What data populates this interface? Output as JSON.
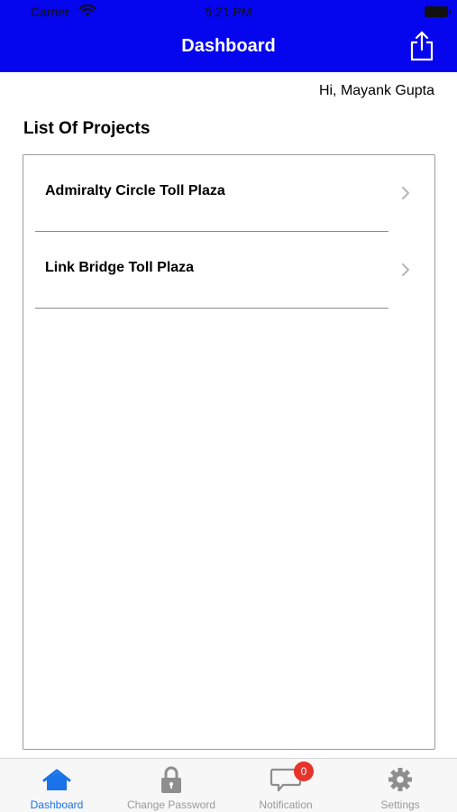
{
  "status_bar": {
    "carrier": "Carrier",
    "time": "5:21 PM"
  },
  "header": {
    "title": "Dashboard"
  },
  "greeting": "Hi, Mayank Gupta",
  "section_title": "List Of Projects",
  "projects": [
    {
      "name": "Admiralty Circle Toll Plaza"
    },
    {
      "name": "Link Bridge Toll Plaza"
    }
  ],
  "tabs": [
    {
      "label": "Dashboard",
      "icon": "home-icon",
      "active": true
    },
    {
      "label": "Change Password",
      "icon": "lock-icon",
      "active": false
    },
    {
      "label": "Notification",
      "icon": "chat-bubble-icon",
      "active": false,
      "badge": "0"
    },
    {
      "label": "Settings",
      "icon": "gear-icon",
      "active": false
    }
  ],
  "colors": {
    "header_bg": "#0505ee",
    "active_tab": "#1a73e8",
    "inactive_tab": "#9a9a9a",
    "badge": "#e8332b"
  }
}
